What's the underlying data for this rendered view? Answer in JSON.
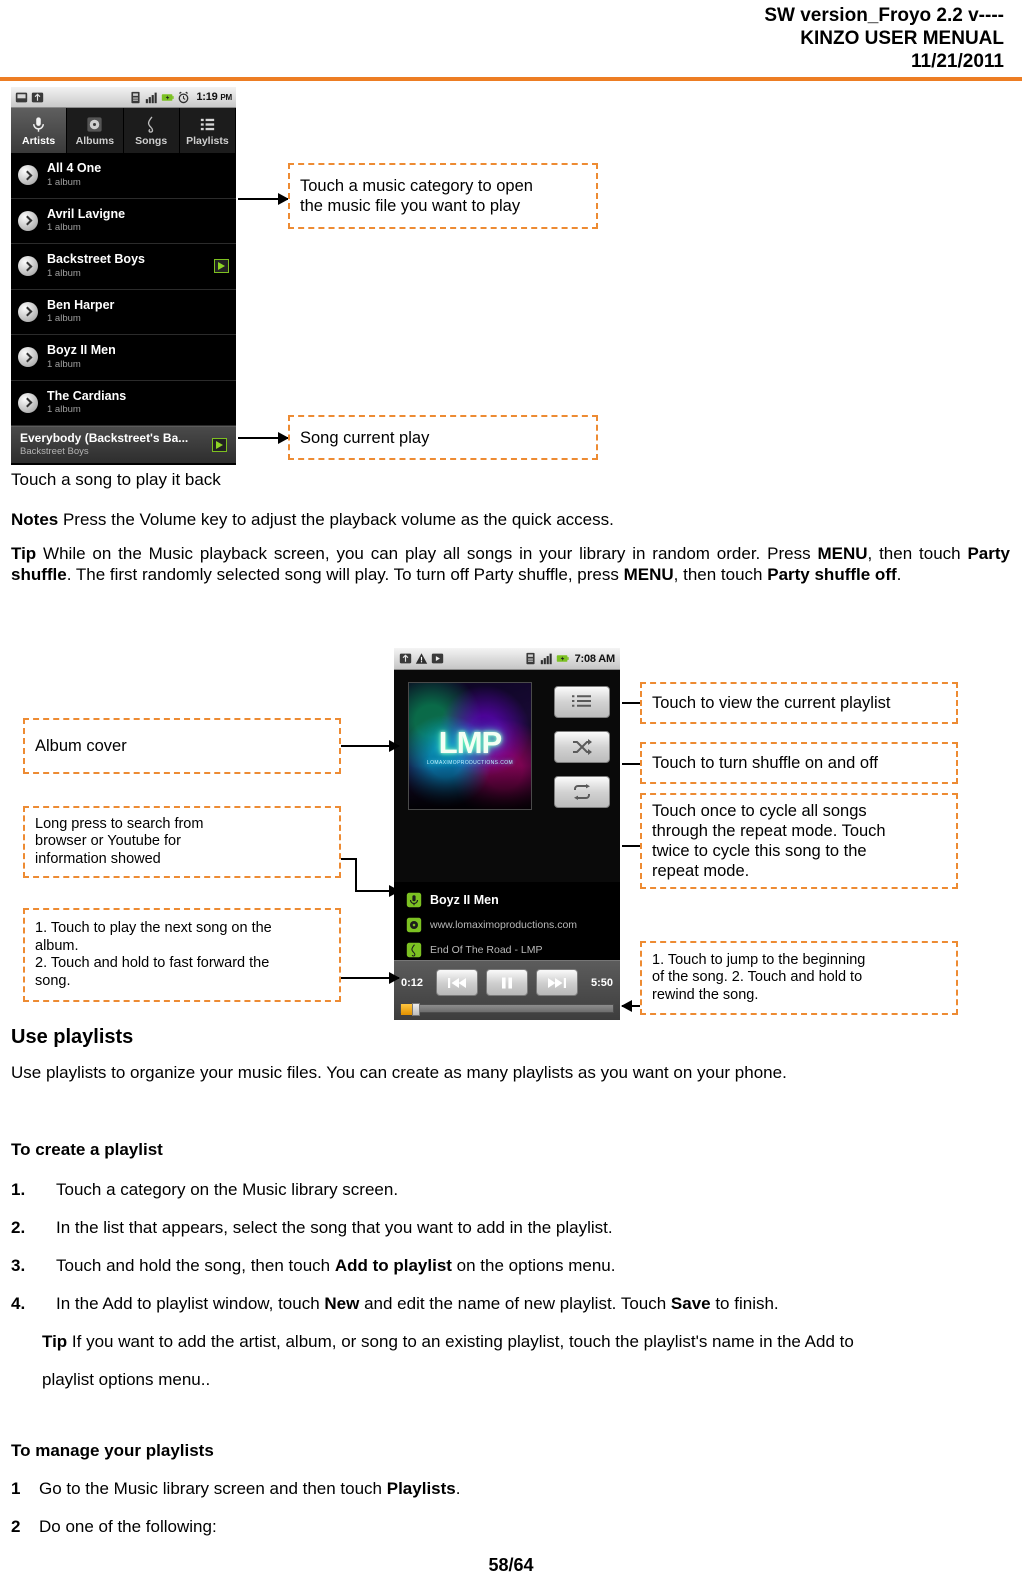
{
  "header": {
    "line1": "SW version_Froyo 2.2 v----",
    "line2": "KINZO USER MENUAL",
    "line3": "11/21/2011",
    "rule_color": "#ED7D23"
  },
  "phone_library": {
    "statusbar": {
      "time": "1:19",
      "meridiem": "PM",
      "left_icons": [
        "sd-card-icon",
        "usb-icon"
      ],
      "right_icons": [
        "sim-icon",
        "signal-icon",
        "battery-icon",
        "alarm-icon"
      ]
    },
    "tabs": [
      {
        "label": "Artists",
        "icon": "microphone-icon",
        "active": true
      },
      {
        "label": "Albums",
        "icon": "disc-icon",
        "active": false
      },
      {
        "label": "Songs",
        "icon": "treble-clef-icon",
        "active": false
      },
      {
        "label": "Playlists",
        "icon": "list-icon",
        "active": false
      }
    ],
    "artists": [
      {
        "name": "All 4 One",
        "albums": "1 album",
        "playing": false
      },
      {
        "name": "Avril Lavigne",
        "albums": "1 album",
        "playing": false
      },
      {
        "name": "Backstreet Boys",
        "albums": "1 album",
        "playing": true
      },
      {
        "name": "Ben Harper",
        "albums": "1 album",
        "playing": false
      },
      {
        "name": "Boyz II Men",
        "albums": "1 album",
        "playing": false
      },
      {
        "name": "The Cardians",
        "albums": "1 album",
        "playing": false
      }
    ],
    "now_playing_bar": {
      "title": "Everybody (Backstreet's Ba...",
      "artist": "Backstreet Boys",
      "badge": "play-icon"
    }
  },
  "callouts": {
    "category": "Touch a music category to open\nthe music file you want to play",
    "song_current": "Song current play",
    "album_cover": "Album cover",
    "long_press": "Long press to search from\nbrowser or Youtube for\ninformation showed",
    "next_song": "1. Touch to play the next song on the\nalbum.\n2. Touch and hold to fast forward the\nsong.",
    "view_playlist": "Touch to view the current playlist",
    "shuffle": "Touch to turn shuffle on and off",
    "repeat": "Touch once to cycle all songs\nthrough the repeat mode.  Touch\ntwice to cycle this song to the\nrepeat mode.",
    "rewind": "1. Touch to jump to the beginning\nof the song. 2. Touch and hold to\nrewind the song.",
    "border_color": "#ED8B33"
  },
  "captions": {
    "touch_song": "Touch a song to play it back"
  },
  "notes": {
    "label": "Notes",
    "text": " Press the Volume key to adjust the playback volume as the quick access."
  },
  "tip_shuffle": {
    "label": "Tip",
    "part1": " While on the Music playback screen, you can play all songs in your library in random order. Press ",
    "bold1": "MENU",
    "part2": ", then touch ",
    "bold2": "Party shuffle",
    "part3": ". The first randomly selected song will play. To turn off Party shuffle, press ",
    "bold3": "MENU",
    "part4": ", then touch ",
    "bold4": "Party shuffle off",
    "part5": "."
  },
  "phone_player": {
    "statusbar": {
      "time": "7:08 AM",
      "left_icons": [
        "usb-icon",
        "warning-icon",
        "play-icon"
      ],
      "right_icons": [
        "sim-icon",
        "signal-icon",
        "battery-icon"
      ]
    },
    "album_art": {
      "title": "LMP",
      "subtitle": "LOMAXIMOPRODUCTIONS.COM"
    },
    "buttons": [
      {
        "name": "playlist-button",
        "icon": "list-icon"
      },
      {
        "name": "shuffle-button",
        "icon": "shuffle-icon"
      },
      {
        "name": "repeat-button",
        "icon": "repeat-icon"
      }
    ],
    "meta": [
      {
        "icon": "microphone-icon",
        "text": "Boyz II Men",
        "primary": true
      },
      {
        "icon": "disc-icon",
        "text": "www.lomaximoproductions.com",
        "primary": false
      },
      {
        "icon": "treble-clef-icon",
        "text": "End Of The Road - LMP",
        "primary": false
      }
    ],
    "transport": {
      "elapsed": "0:12",
      "duration": "5:50",
      "prev": "previous-button",
      "pause": "pause-button",
      "next": "next-button"
    }
  },
  "use_playlists": {
    "heading": "Use playlists",
    "intro": "Use playlists to organize your music files. You can create as many playlists as you want on your phone.",
    "create_heading": "To create a playlist",
    "steps": [
      {
        "num": "1.",
        "pre": "Touch a category on the Music library screen.",
        "bold": "",
        "post": ""
      },
      {
        "num": "2.",
        "pre": "In the list that appears, select the song that you want to add in the playlist.",
        "bold": "",
        "post": ""
      },
      {
        "num": "3.",
        "pre": "Touch and hold the song, then touch ",
        "bold": "Add to playlist",
        "post": " on the options menu."
      },
      {
        "num": "4.",
        "pre": "In the Add to playlist window, touch ",
        "bold": "New",
        "post": " and edit the name of new playlist.  Touch ",
        "bold2": "Save",
        "post2": " to finish."
      }
    ],
    "tip": {
      "label": "Tip",
      "text": " If you want to add the artist, album, or song to an existing playlist, touch the playlist's name in the Add to",
      "line2": "playlist options menu.."
    },
    "manage_heading": "To manage your playlists",
    "manage_steps": [
      {
        "num": "1",
        "pre": "Go to the Music library screen and then touch ",
        "bold": "Playlists",
        "post": "."
      },
      {
        "num": "2",
        "pre": "Do one of the following:",
        "bold": "",
        "post": ""
      }
    ]
  },
  "footer": {
    "page": "58/64"
  }
}
